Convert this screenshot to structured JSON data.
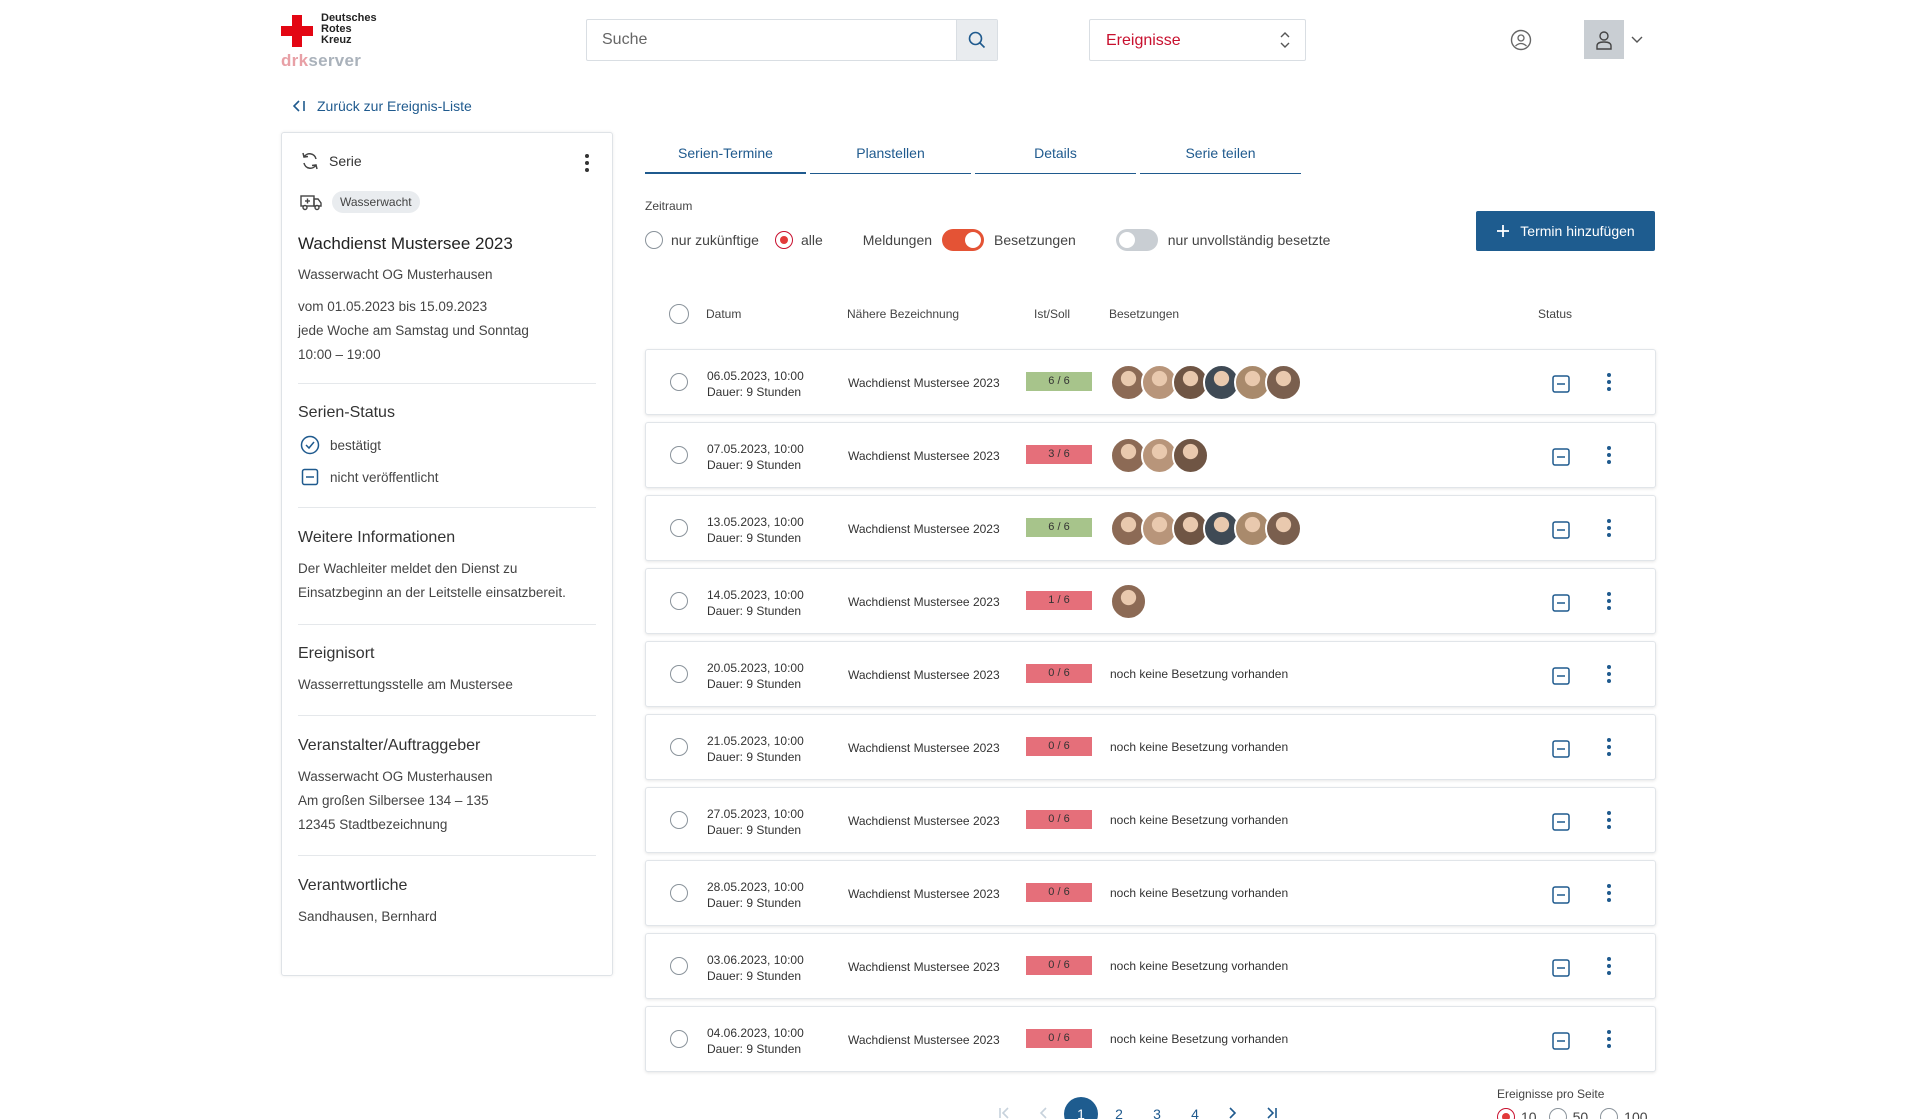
{
  "logo": {
    "line1": "Deutsches",
    "line2": "Rotes",
    "line3": "Kreuz",
    "sub_prefix": "drk",
    "sub_suffix": "server"
  },
  "search": {
    "placeholder": "Suche"
  },
  "selector": {
    "value": "Ereignisse"
  },
  "back_link": "Zurück zur Ereignis-Liste",
  "sidebar": {
    "type_label": "Serie",
    "tag": "Wasserwacht",
    "title": "Wachdienst Mustersee 2023",
    "org": "Wasserwacht OG Musterhausen",
    "date_range": "vom 01.05.2023 bis 15.09.2023",
    "recurrence": "jede Woche am Samstag und Sonntag",
    "time": "10:00 – 19:00",
    "status_heading": "Serien-Status",
    "status_confirmed": "bestätigt",
    "status_unpublished": "nicht veröffentlicht",
    "info_heading": "Weitere Informationen",
    "info_line1": "Der Wachleiter meldet den Dienst zu",
    "info_line2": "Einsatzbeginn an der Leitstelle einsatzbereit.",
    "place_heading": "Ereignisort",
    "place": "Wasserrettungsstelle am Mustersee",
    "organizer_heading": "Veranstalter/Auftraggeber",
    "organizer_name": "Wasserwacht OG Musterhausen",
    "organizer_street": "Am großen Silbersee 134 – 135",
    "organizer_city": "12345 Stadtbezeichnung",
    "responsible_heading": "Verantwortliche",
    "responsible": "Sandhausen, Bernhard"
  },
  "tabs": [
    "Serien-Termine",
    "Planstellen",
    "Details",
    "Serie teilen"
  ],
  "filters": {
    "zeitraum": "Zeitraum",
    "future": "nur zukünftige",
    "all": "alle",
    "meldungen": "Meldungen",
    "besetzungen": "Besetzungen",
    "incomplete": "nur unvollständig besetzte"
  },
  "add_button": "Termin hinzufügen",
  "columns": {
    "date": "Datum",
    "name": "Nähere Bezeichnung",
    "ratio": "Ist/Soll",
    "staff": "Besetzungen",
    "status": "Status"
  },
  "rows": [
    {
      "date": "06.05.2023, 10:00",
      "duration": "Dauer: 9 Stunden",
      "name": "Wachdienst Mustersee 2023",
      "ratio": "6 / 6",
      "level": "ok",
      "avatars": 6,
      "none": ""
    },
    {
      "date": "07.05.2023, 10:00",
      "duration": "Dauer: 9 Stunden",
      "name": "Wachdienst Mustersee 2023",
      "ratio": "3 / 6",
      "level": "low",
      "avatars": 3,
      "none": ""
    },
    {
      "date": "13.05.2023, 10:00",
      "duration": "Dauer: 9 Stunden",
      "name": "Wachdienst Mustersee 2023",
      "ratio": "6 / 6",
      "level": "ok",
      "avatars": 6,
      "none": ""
    },
    {
      "date": "14.05.2023, 10:00",
      "duration": "Dauer: 9 Stunden",
      "name": "Wachdienst Mustersee 2023",
      "ratio": "1 / 6",
      "level": "low",
      "avatars": 1,
      "none": ""
    },
    {
      "date": "20.05.2023, 10:00",
      "duration": "Dauer: 9 Stunden",
      "name": "Wachdienst Mustersee 2023",
      "ratio": "0 / 6",
      "level": "low",
      "avatars": 0,
      "none": "noch keine Besetzung vorhanden"
    },
    {
      "date": "21.05.2023, 10:00",
      "duration": "Dauer: 9 Stunden",
      "name": "Wachdienst Mustersee 2023",
      "ratio": "0 / 6",
      "level": "low",
      "avatars": 0,
      "none": "noch keine Besetzung vorhanden"
    },
    {
      "date": "27.05.2023, 10:00",
      "duration": "Dauer: 9 Stunden",
      "name": "Wachdienst Mustersee 2023",
      "ratio": "0 / 6",
      "level": "low",
      "avatars": 0,
      "none": "noch keine Besetzung vorhanden"
    },
    {
      "date": "28.05.2023, 10:00",
      "duration": "Dauer: 9 Stunden",
      "name": "Wachdienst Mustersee 2023",
      "ratio": "0 / 6",
      "level": "low",
      "avatars": 0,
      "none": "noch keine Besetzung vorhanden"
    },
    {
      "date": "03.06.2023, 10:00",
      "duration": "Dauer: 9 Stunden",
      "name": "Wachdienst Mustersee 2023",
      "ratio": "0 / 6",
      "level": "low",
      "avatars": 0,
      "none": "noch keine Besetzung vorhanden"
    },
    {
      "date": "04.06.2023, 10:00",
      "duration": "Dauer: 9 Stunden",
      "name": "Wachdienst Mustersee 2023",
      "ratio": "0 / 6",
      "level": "low",
      "avatars": 0,
      "none": "noch keine Besetzung vorhanden"
    }
  ],
  "pagination": {
    "pages": [
      "1",
      "2",
      "3",
      "4"
    ],
    "current": "1"
  },
  "per_page": {
    "label": "Ereignisse pro Seite",
    "options": [
      "10",
      "50",
      "100"
    ],
    "selected": "10"
  },
  "colors": {
    "brand_red": "#e30613",
    "primary_blue": "#1e5c8f",
    "badge_ok": "#a7c48b",
    "badge_low": "#e56f7a",
    "toggle_on": "#e45335"
  }
}
